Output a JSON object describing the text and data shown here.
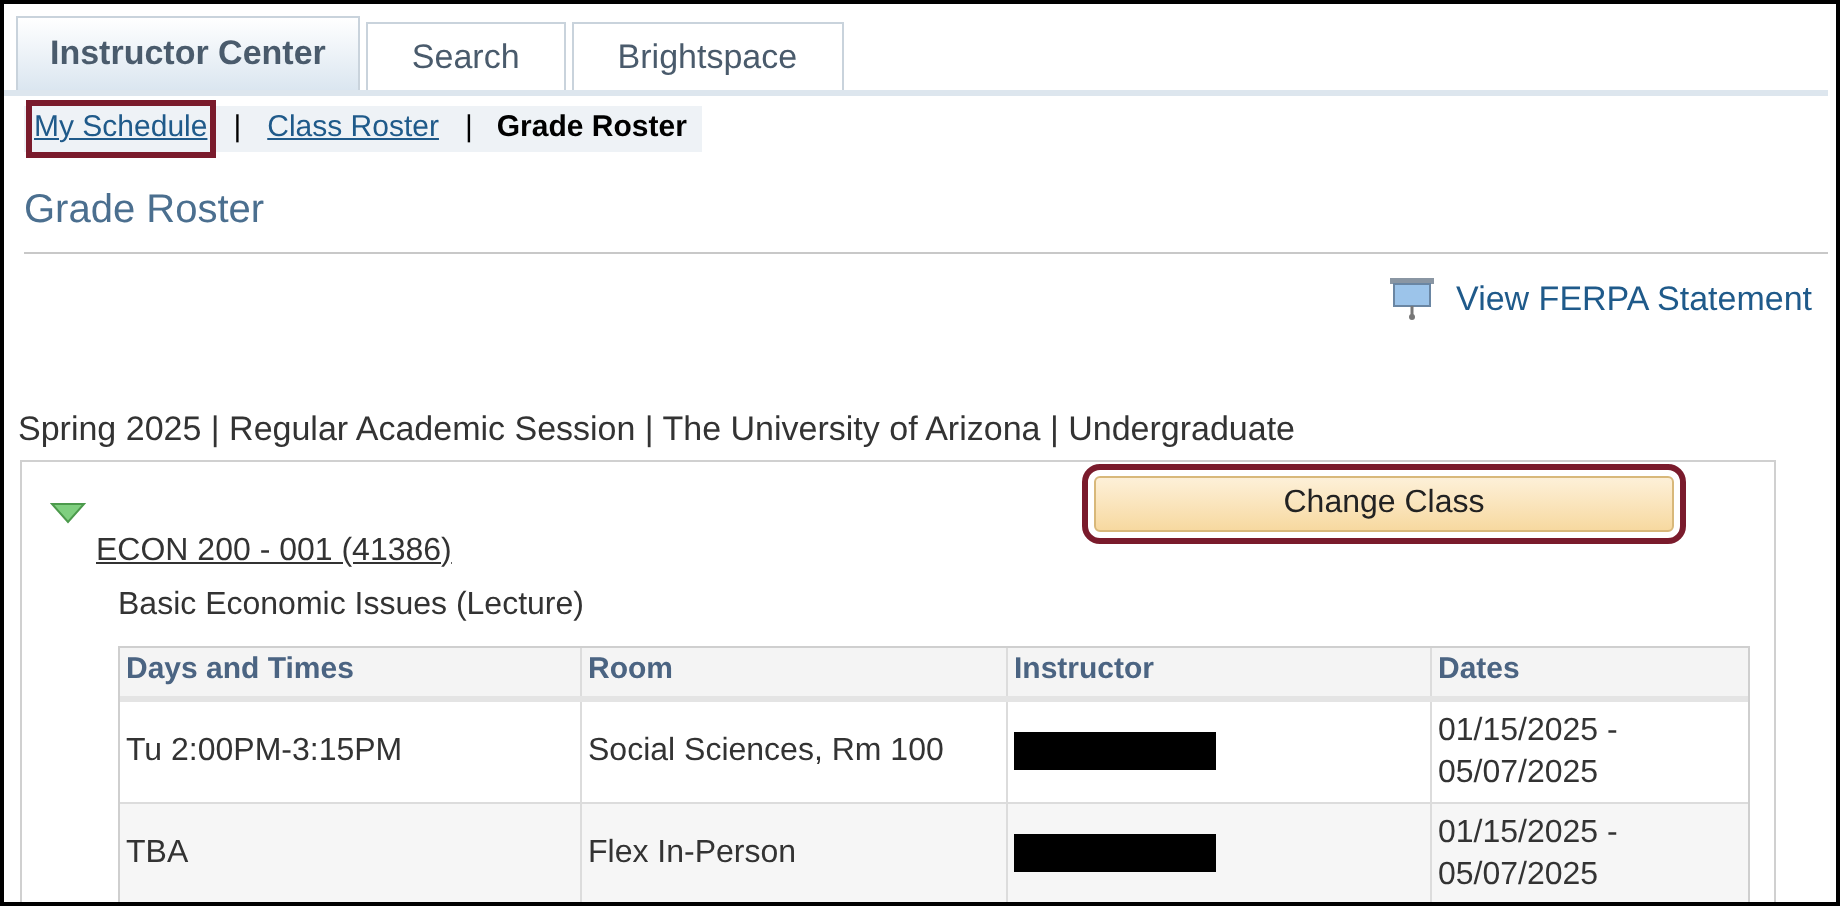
{
  "tabs": [
    {
      "label": "Instructor Center",
      "selected": true
    },
    {
      "label": "Search",
      "selected": false
    },
    {
      "label": "Brightspace",
      "selected": false
    }
  ],
  "subnav": [
    {
      "label": "My Schedule",
      "current": false,
      "highlighted": true
    },
    {
      "label": "Class Roster",
      "current": false,
      "highlighted": false
    },
    {
      "label": "Grade Roster",
      "current": true,
      "highlighted": false
    }
  ],
  "separator": "|",
  "page_title": "Grade Roster",
  "ferpa_link": "View FERPA Statement",
  "session_line": "Spring 2025 | Regular Academic Session | The University of Arizona | Undergraduate",
  "class_section": {
    "expanded": true,
    "class_link": "ECON 200 - 001 (41386)",
    "description": "Basic Economic Issues (Lecture)",
    "change_button": {
      "label": "Change Class",
      "highlighted": true
    },
    "table": {
      "columns": [
        "Days and Times",
        "Room",
        "Instructor",
        "Dates"
      ],
      "rows": [
        [
          {
            "kind": "text",
            "text": "Tu 2:00PM-3:15PM"
          },
          {
            "kind": "text",
            "text": "Social Sciences, Rm 100"
          },
          {
            "kind": "redacted"
          },
          {
            "kind": "text",
            "text": "01/15/2025 - 05/07/2025"
          }
        ],
        [
          {
            "kind": "text",
            "text": "TBA"
          },
          {
            "kind": "text",
            "text": "Flex In-Person"
          },
          {
            "kind": "redacted"
          },
          {
            "kind": "text",
            "text": "01/15/2025 - 05/07/2025"
          }
        ]
      ]
    }
  }
}
